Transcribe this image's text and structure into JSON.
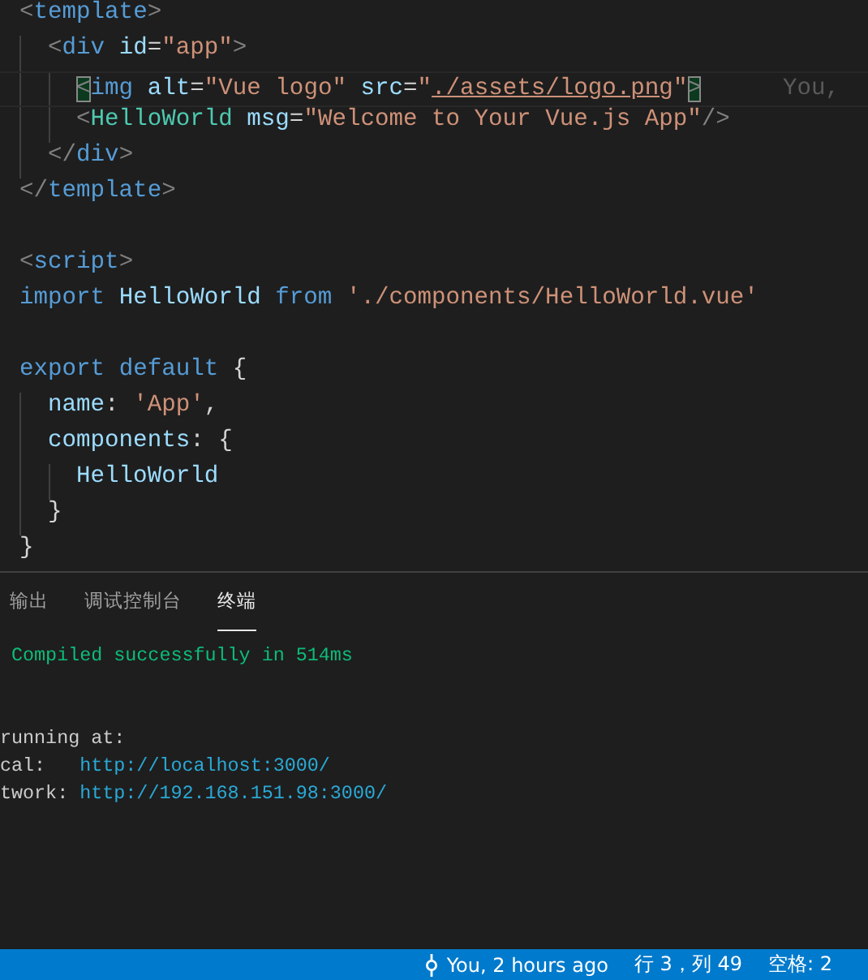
{
  "editor": {
    "lines": [
      {
        "kind": "code",
        "tokens": [
          {
            "text": "<",
            "kind": "punct"
          },
          {
            "text": "template",
            "kind": "tag"
          },
          {
            "text": ">",
            "kind": "punct"
          }
        ]
      },
      {
        "kind": "code",
        "tokens": [
          {
            "text": "  <",
            "kind": "punct"
          },
          {
            "text": "div",
            "kind": "tag"
          },
          {
            "text": " id",
            "kind": "attr"
          },
          {
            "text": "=",
            "kind": "plain"
          },
          {
            "text": "\"app\"",
            "kind": "string"
          },
          {
            "text": ">",
            "kind": "punct"
          }
        ]
      },
      {
        "kind": "code",
        "current": true,
        "blame": "You,",
        "tokens": [
          {
            "text": "    <",
            "kind": "bracket-match"
          },
          {
            "text": "img",
            "kind": "tag"
          },
          {
            "text": " alt",
            "kind": "attr"
          },
          {
            "text": "=",
            "kind": "plain"
          },
          {
            "text": "\"Vue logo\"",
            "kind": "string"
          },
          {
            "text": " src",
            "kind": "attr"
          },
          {
            "text": "=",
            "kind": "plain"
          },
          {
            "text": "\"",
            "kind": "string"
          },
          {
            "text": "./assets/logo.png",
            "kind": "link"
          },
          {
            "text": "\"",
            "kind": "string"
          },
          {
            "text": ">",
            "kind": "bracket-match"
          }
        ]
      },
      {
        "kind": "code",
        "tokens": [
          {
            "text": "    <",
            "kind": "punct"
          },
          {
            "text": "HelloWorld",
            "kind": "component"
          },
          {
            "text": " msg",
            "kind": "attr"
          },
          {
            "text": "=",
            "kind": "plain"
          },
          {
            "text": "\"Welcome to Your Vue.js App\"",
            "kind": "string"
          },
          {
            "text": "/>",
            "kind": "punct"
          }
        ]
      },
      {
        "kind": "code",
        "tokens": [
          {
            "text": "  </",
            "kind": "punct"
          },
          {
            "text": "div",
            "kind": "tag"
          },
          {
            "text": ">",
            "kind": "punct"
          }
        ]
      },
      {
        "kind": "code",
        "tokens": [
          {
            "text": "</",
            "kind": "punct"
          },
          {
            "text": "template",
            "kind": "tag"
          },
          {
            "text": ">",
            "kind": "punct"
          }
        ]
      },
      {
        "kind": "blank"
      },
      {
        "kind": "code",
        "tokens": [
          {
            "text": "<",
            "kind": "punct"
          },
          {
            "text": "script",
            "kind": "tag"
          },
          {
            "text": ">",
            "kind": "punct"
          }
        ]
      },
      {
        "kind": "code",
        "tokens": [
          {
            "text": "import",
            "kind": "keyword"
          },
          {
            "text": " HelloWorld",
            "kind": "ident"
          },
          {
            "text": " from",
            "kind": "keyword"
          },
          {
            "text": " './components/HelloWorld.vue'",
            "kind": "string"
          }
        ]
      },
      {
        "kind": "blank"
      },
      {
        "kind": "code",
        "tokens": [
          {
            "text": "export",
            "kind": "keyword"
          },
          {
            "text": " default",
            "kind": "keyword"
          },
          {
            "text": " {",
            "kind": "plain"
          }
        ]
      },
      {
        "kind": "code",
        "tokens": [
          {
            "text": "  name",
            "kind": "ident"
          },
          {
            "text": ": ",
            "kind": "plain"
          },
          {
            "text": "'App'",
            "kind": "string"
          },
          {
            "text": ",",
            "kind": "plain"
          }
        ]
      },
      {
        "kind": "code",
        "tokens": [
          {
            "text": "  components",
            "kind": "ident"
          },
          {
            "text": ": {",
            "kind": "plain"
          }
        ]
      },
      {
        "kind": "code",
        "tokens": [
          {
            "text": "    HelloWorld",
            "kind": "ident"
          }
        ]
      },
      {
        "kind": "code",
        "tokens": [
          {
            "text": "  }",
            "kind": "plain"
          }
        ]
      },
      {
        "kind": "code",
        "tokens": [
          {
            "text": "}",
            "kind": "plain"
          }
        ]
      }
    ]
  },
  "panel": {
    "tabs": [
      {
        "label": "输出",
        "selected": false
      },
      {
        "label": "调试控制台",
        "selected": false
      },
      {
        "label": "终端",
        "selected": true
      }
    ],
    "terminal": [
      {
        "kind": "text",
        "tokens": [
          {
            "text": " Compiled successfully in 514ms",
            "kind": "success"
          }
        ]
      },
      {
        "kind": "blank"
      },
      {
        "kind": "blank"
      },
      {
        "kind": "text",
        "tokens": [
          {
            "text": "running at:",
            "kind": "plain"
          }
        ]
      },
      {
        "kind": "text",
        "tokens": [
          {
            "text": "cal:   ",
            "kind": "plain"
          },
          {
            "text": "http://localhost:",
            "kind": "url"
          },
          {
            "text": "3000",
            "kind": "url-port"
          },
          {
            "text": "/",
            "kind": "url"
          }
        ]
      },
      {
        "kind": "text",
        "tokens": [
          {
            "text": "twork: ",
            "kind": "plain"
          },
          {
            "text": "http://192.168.151.98:",
            "kind": "url"
          },
          {
            "text": "3000",
            "kind": "url-port"
          },
          {
            "text": "/",
            "kind": "url"
          }
        ]
      }
    ]
  },
  "status_bar": {
    "blame": "You, 2 hours ago",
    "position": "行 3，列 49",
    "indentation": "空格: 2"
  }
}
